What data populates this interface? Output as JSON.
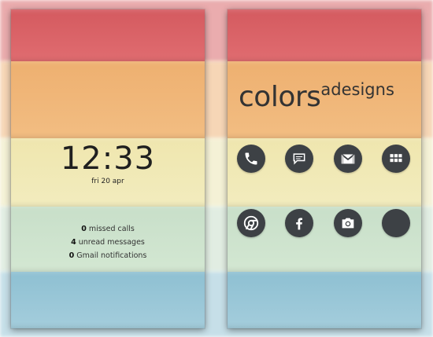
{
  "lockscreen": {
    "time": "12:33",
    "date": "fri 20 apr",
    "notifications": [
      {
        "count": "0",
        "text": "missed calls"
      },
      {
        "count": "4",
        "text": "unread messages"
      },
      {
        "count": "0",
        "text": "Gmail notifications"
      }
    ]
  },
  "homescreen": {
    "logo_main": "colors",
    "logo_sub": "adesigns",
    "icons_row1": [
      "phone-icon",
      "messages-icon",
      "gmail-icon",
      "app-drawer-icon"
    ],
    "icons_row2": [
      "chrome-icon",
      "facebook-icon",
      "camera-icon",
      "blank-icon"
    ]
  },
  "colors": {
    "red": "#d45a5f",
    "orange": "#eeb070",
    "yellow": "#efe6ae",
    "green": "#c8dfc9",
    "blue": "#8ec0d2",
    "icon_bg": "#3d4145"
  }
}
